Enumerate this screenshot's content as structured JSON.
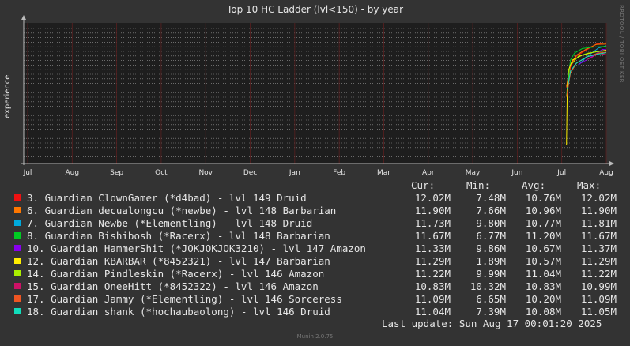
{
  "title": "Top 10 HC Ladder (lvl<150) - by year",
  "vertical_label": "experience",
  "side_text": "RRDTOOL / TOBI OETIKER",
  "columns": [
    "Cur:",
    "Min:",
    "Avg:",
    "Max:"
  ],
  "legend": [
    {
      "label": "3. Guardian ClownGamer (*d4bad) - lvl 149 Druid",
      "color": "#ee1111",
      "cur": "12.02M",
      "min": "7.48M",
      "avg": "10.76M",
      "max": "12.02M"
    },
    {
      "label": "6. Guardian decualongcu (*newbe) - lvl 148 Barbarian",
      "color": "#ff7700",
      "cur": "11.90M",
      "min": "7.66M",
      "avg": "10.96M",
      "max": "11.90M"
    },
    {
      "label": "7. Guardian Newbe (*Elementling) - lvl 148 Druid",
      "color": "#00aadd",
      "cur": "11.73M",
      "min": "9.80M",
      "avg": "10.77M",
      "max": "11.81M"
    },
    {
      "label": "8. Guardian Bishibosh (*Racerx) - lvl 148 Barbarian",
      "color": "#00cc22",
      "cur": "11.67M",
      "min": "6.77M",
      "avg": "11.20M",
      "max": "11.67M"
    },
    {
      "label": "10. Guardian HammerShit (*JOKJOKJOK3210) - lvl 147 Amazon",
      "color": "#8800ee",
      "cur": "11.33M",
      "min": "9.86M",
      "avg": "10.67M",
      "max": "11.37M"
    },
    {
      "label": "12. Guardian KBARBAR (*8452321) - lvl 147 Barbarian",
      "color": "#ffee00",
      "cur": "11.29M",
      "min": "1.89M",
      "avg": "10.57M",
      "max": "11.29M"
    },
    {
      "label": "14. Guardian Pindleskin (*Racerx) - lvl 146 Amazon",
      "color": "#aaee00",
      "cur": "11.22M",
      "min": "9.99M",
      "avg": "11.04M",
      "max": "11.22M"
    },
    {
      "label": "15. Guardian OneeHitt (*8452322) - lvl 146 Amazon",
      "color": "#cc1166",
      "cur": "10.83M",
      "min": "10.32M",
      "avg": "10.83M",
      "max": "10.99M"
    },
    {
      "label": "17. Guardian Jammy (*Elementling) - lvl 146 Sorceress",
      "color": "#ee5522",
      "cur": "11.09M",
      "min": "6.65M",
      "avg": "10.20M",
      "max": "11.09M"
    },
    {
      "label": "18. Guardian shank (*hochaubaolong) - lvl 146 Druid",
      "color": "#11ddbb",
      "cur": "11.04M",
      "min": "7.39M",
      "avg": "10.08M",
      "max": "11.05M"
    }
  ],
  "last_update": "Last update: Sun Aug 17 00:01:20 2025",
  "footer": "Munin 2.0.75",
  "chart_data": {
    "type": "line",
    "title": "Top 10 HC Ladder (lvl<150) - by year",
    "ylabel": "experience",
    "x_ticks": [
      "Jul",
      "Aug",
      "Sep",
      "Oct",
      "Nov",
      "Dec",
      "Jan",
      "Feb",
      "Mar",
      "Apr",
      "May",
      "Jun",
      "Jul",
      "Aug"
    ],
    "grid": true,
    "series": [
      {
        "name": "3. Guardian ClownGamer (*d4bad) - lvl 149 Druid",
        "color": "#ee1111",
        "x": [
          0.0,
          0.1,
          0.25,
          0.5,
          0.75,
          1.0
        ],
        "values": [
          7.48,
          9.6,
          10.7,
          11.3,
          11.9,
          12.02
        ]
      },
      {
        "name": "6. Guardian decualongcu (*newbe) - lvl 148 Barbarian",
        "color": "#ff7700",
        "x": [
          0.0,
          0.1,
          0.25,
          0.5,
          0.75,
          1.0
        ],
        "values": [
          7.66,
          9.8,
          10.8,
          11.4,
          11.85,
          11.9
        ]
      },
      {
        "name": "7. Guardian Newbe (*Elementling) - lvl 148 Druid",
        "color": "#00aadd",
        "x": [
          0.3,
          0.45,
          0.6,
          0.8,
          1.0
        ],
        "values": [
          9.8,
          10.4,
          10.9,
          11.5,
          11.73
        ]
      },
      {
        "name": "8. Guardian Bishibosh (*Racerx) - lvl 148 Barbarian",
        "color": "#00cc22",
        "x": [
          0.0,
          0.1,
          0.2,
          0.4,
          0.7,
          1.0
        ],
        "values": [
          6.77,
          10.3,
          11.0,
          11.45,
          11.6,
          11.67
        ]
      },
      {
        "name": "10. Guardian HammerShit (*JOKJOKJOK3210) - lvl 147 Amazon",
        "color": "#8800ee",
        "x": [
          0.3,
          0.5,
          0.7,
          0.9,
          1.0
        ],
        "values": [
          9.86,
          10.3,
          10.8,
          11.37,
          11.33
        ]
      },
      {
        "name": "12. Guardian KBARBAR (*8452321) - lvl 147 Barbarian",
        "color": "#ffee00",
        "x": [
          0.0,
          0.02,
          0.05,
          0.15,
          0.4,
          0.7,
          1.0
        ],
        "values": [
          1.89,
          7.5,
          9.3,
          10.3,
          10.8,
          11.1,
          11.29
        ]
      },
      {
        "name": "14. Guardian Pindleskin (*Racerx) - lvl 146 Amazon",
        "color": "#aaee00",
        "x": [
          0.15,
          0.3,
          0.55,
          0.8,
          1.0
        ],
        "values": [
          9.99,
          10.7,
          11.0,
          11.15,
          11.22
        ]
      },
      {
        "name": "15. Guardian OneeHitt (*8452322) - lvl 146 Amazon",
        "color": "#cc1166",
        "x": [
          0.5,
          0.65,
          0.8,
          1.0
        ],
        "values": [
          10.32,
          10.6,
          10.99,
          10.83
        ]
      },
      {
        "name": "17. Guardian Jammy (*Elementling) - lvl 146 Sorceress",
        "color": "#ee5522",
        "x": [
          0.0,
          0.1,
          0.25,
          0.5,
          0.8,
          1.0
        ],
        "values": [
          6.65,
          9.0,
          10.0,
          10.6,
          11.0,
          11.09
        ]
      },
      {
        "name": "18. Guardian shank (*hochaubaolong) - lvl 146 Druid",
        "color": "#11ddbb",
        "x": [
          0.02,
          0.1,
          0.25,
          0.5,
          0.8,
          1.0
        ],
        "values": [
          7.39,
          9.2,
          10.0,
          10.6,
          10.9,
          11.04
        ]
      }
    ]
  }
}
